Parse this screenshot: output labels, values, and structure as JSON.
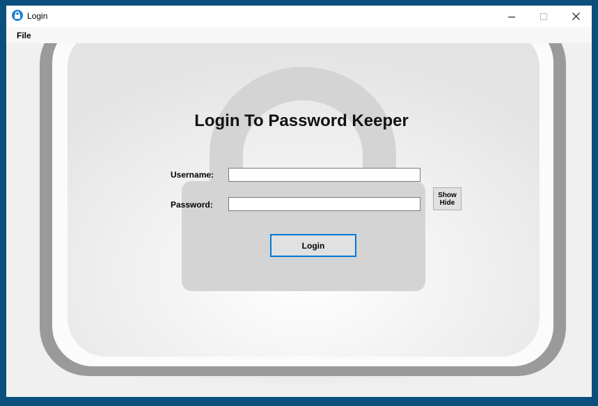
{
  "window": {
    "title": "Login",
    "controls": [
      "minimize",
      "maximize",
      "close"
    ]
  },
  "menu": {
    "items": [
      {
        "label": "File"
      }
    ]
  },
  "form": {
    "heading": "Login To Password Keeper",
    "username_label": "Username:",
    "username_value": "",
    "password_label": "Password:",
    "password_value": "",
    "show_label": "Show",
    "hide_label": "Hide",
    "login_label": "Login"
  },
  "icons": {
    "app": "lock-icon",
    "background": "padlock-graphic"
  },
  "colors": {
    "accent": "#0078d7",
    "app_icon": "#1e7fd0",
    "desktop": "#0b4f7c"
  }
}
